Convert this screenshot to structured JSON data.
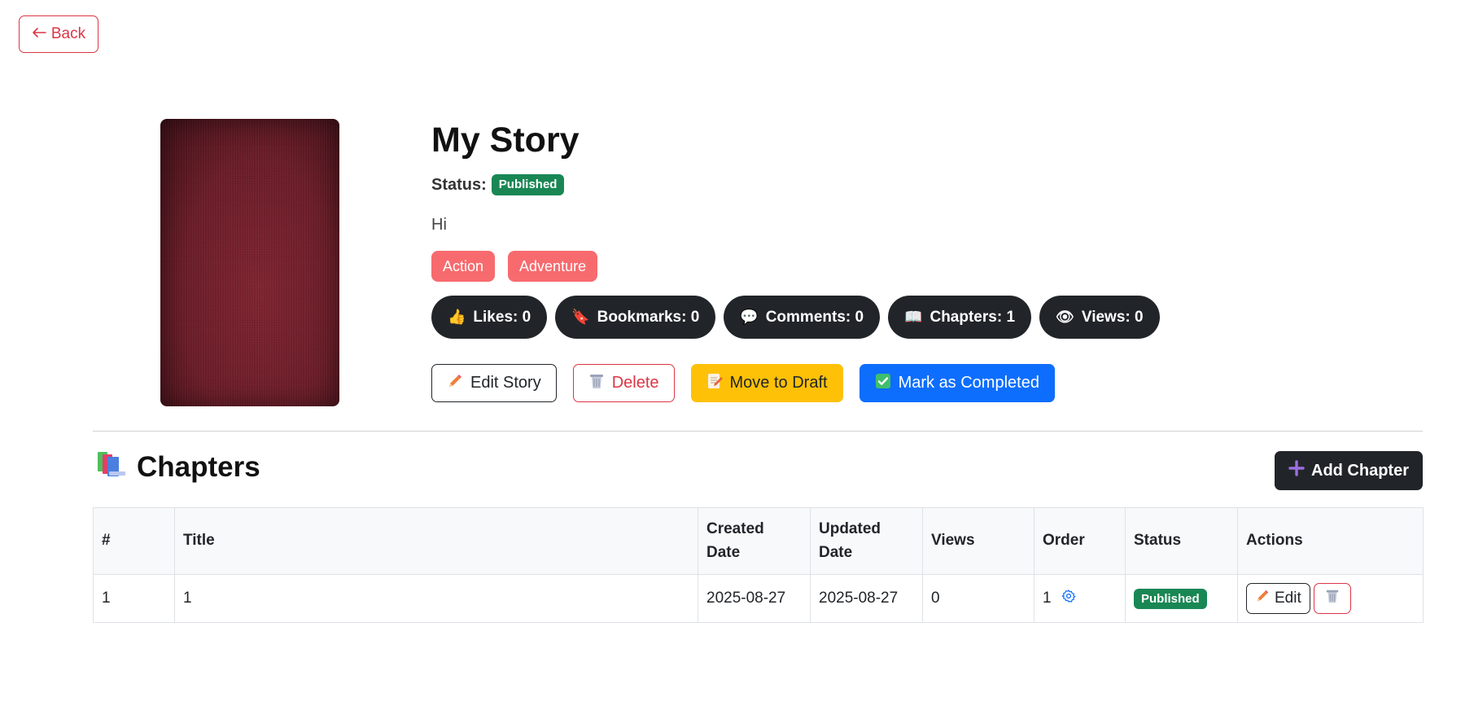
{
  "back_label": "Back",
  "story": {
    "title": "My Story",
    "status_label": "Status:",
    "status": "Published",
    "description": "Hi",
    "genres": [
      "Action",
      "Adventure"
    ],
    "stats": [
      {
        "icon": "thumbs-up-icon",
        "glyph": "👍",
        "label": "Likes: 0"
      },
      {
        "icon": "bookmark-tag-icon",
        "glyph": "🔖",
        "label": "Bookmarks: 0"
      },
      {
        "icon": "speech-bubble-icon",
        "glyph": "💬",
        "label": "Comments: 0"
      },
      {
        "icon": "open-book-icon",
        "glyph": "📖",
        "label": "Chapters: 1"
      },
      {
        "icon": "eye-icon",
        "glyph": "👁",
        "label": "Views: 0"
      }
    ],
    "actions": {
      "edit": "Edit Story",
      "delete": "Delete",
      "draft": "Move to Draft",
      "complete": "Mark as Completed"
    }
  },
  "chapters": {
    "heading": "Chapters",
    "add_label": "Add Chapter",
    "columns": [
      "#",
      "Title",
      "Created Date",
      "Updated Date",
      "Views",
      "Order",
      "Status",
      "Actions"
    ],
    "rows": [
      {
        "num": "1",
        "title": "1",
        "created": "2025-08-27",
        "updated": "2025-08-27",
        "views": "0",
        "order": "1",
        "status": "Published",
        "edit_label": "Edit"
      }
    ]
  },
  "colors": {
    "published": "#198754",
    "danger": "#dc3545",
    "warning": "#ffc107",
    "primary": "#0d6efd",
    "dark": "#212529",
    "genre": "#f76b6e"
  }
}
